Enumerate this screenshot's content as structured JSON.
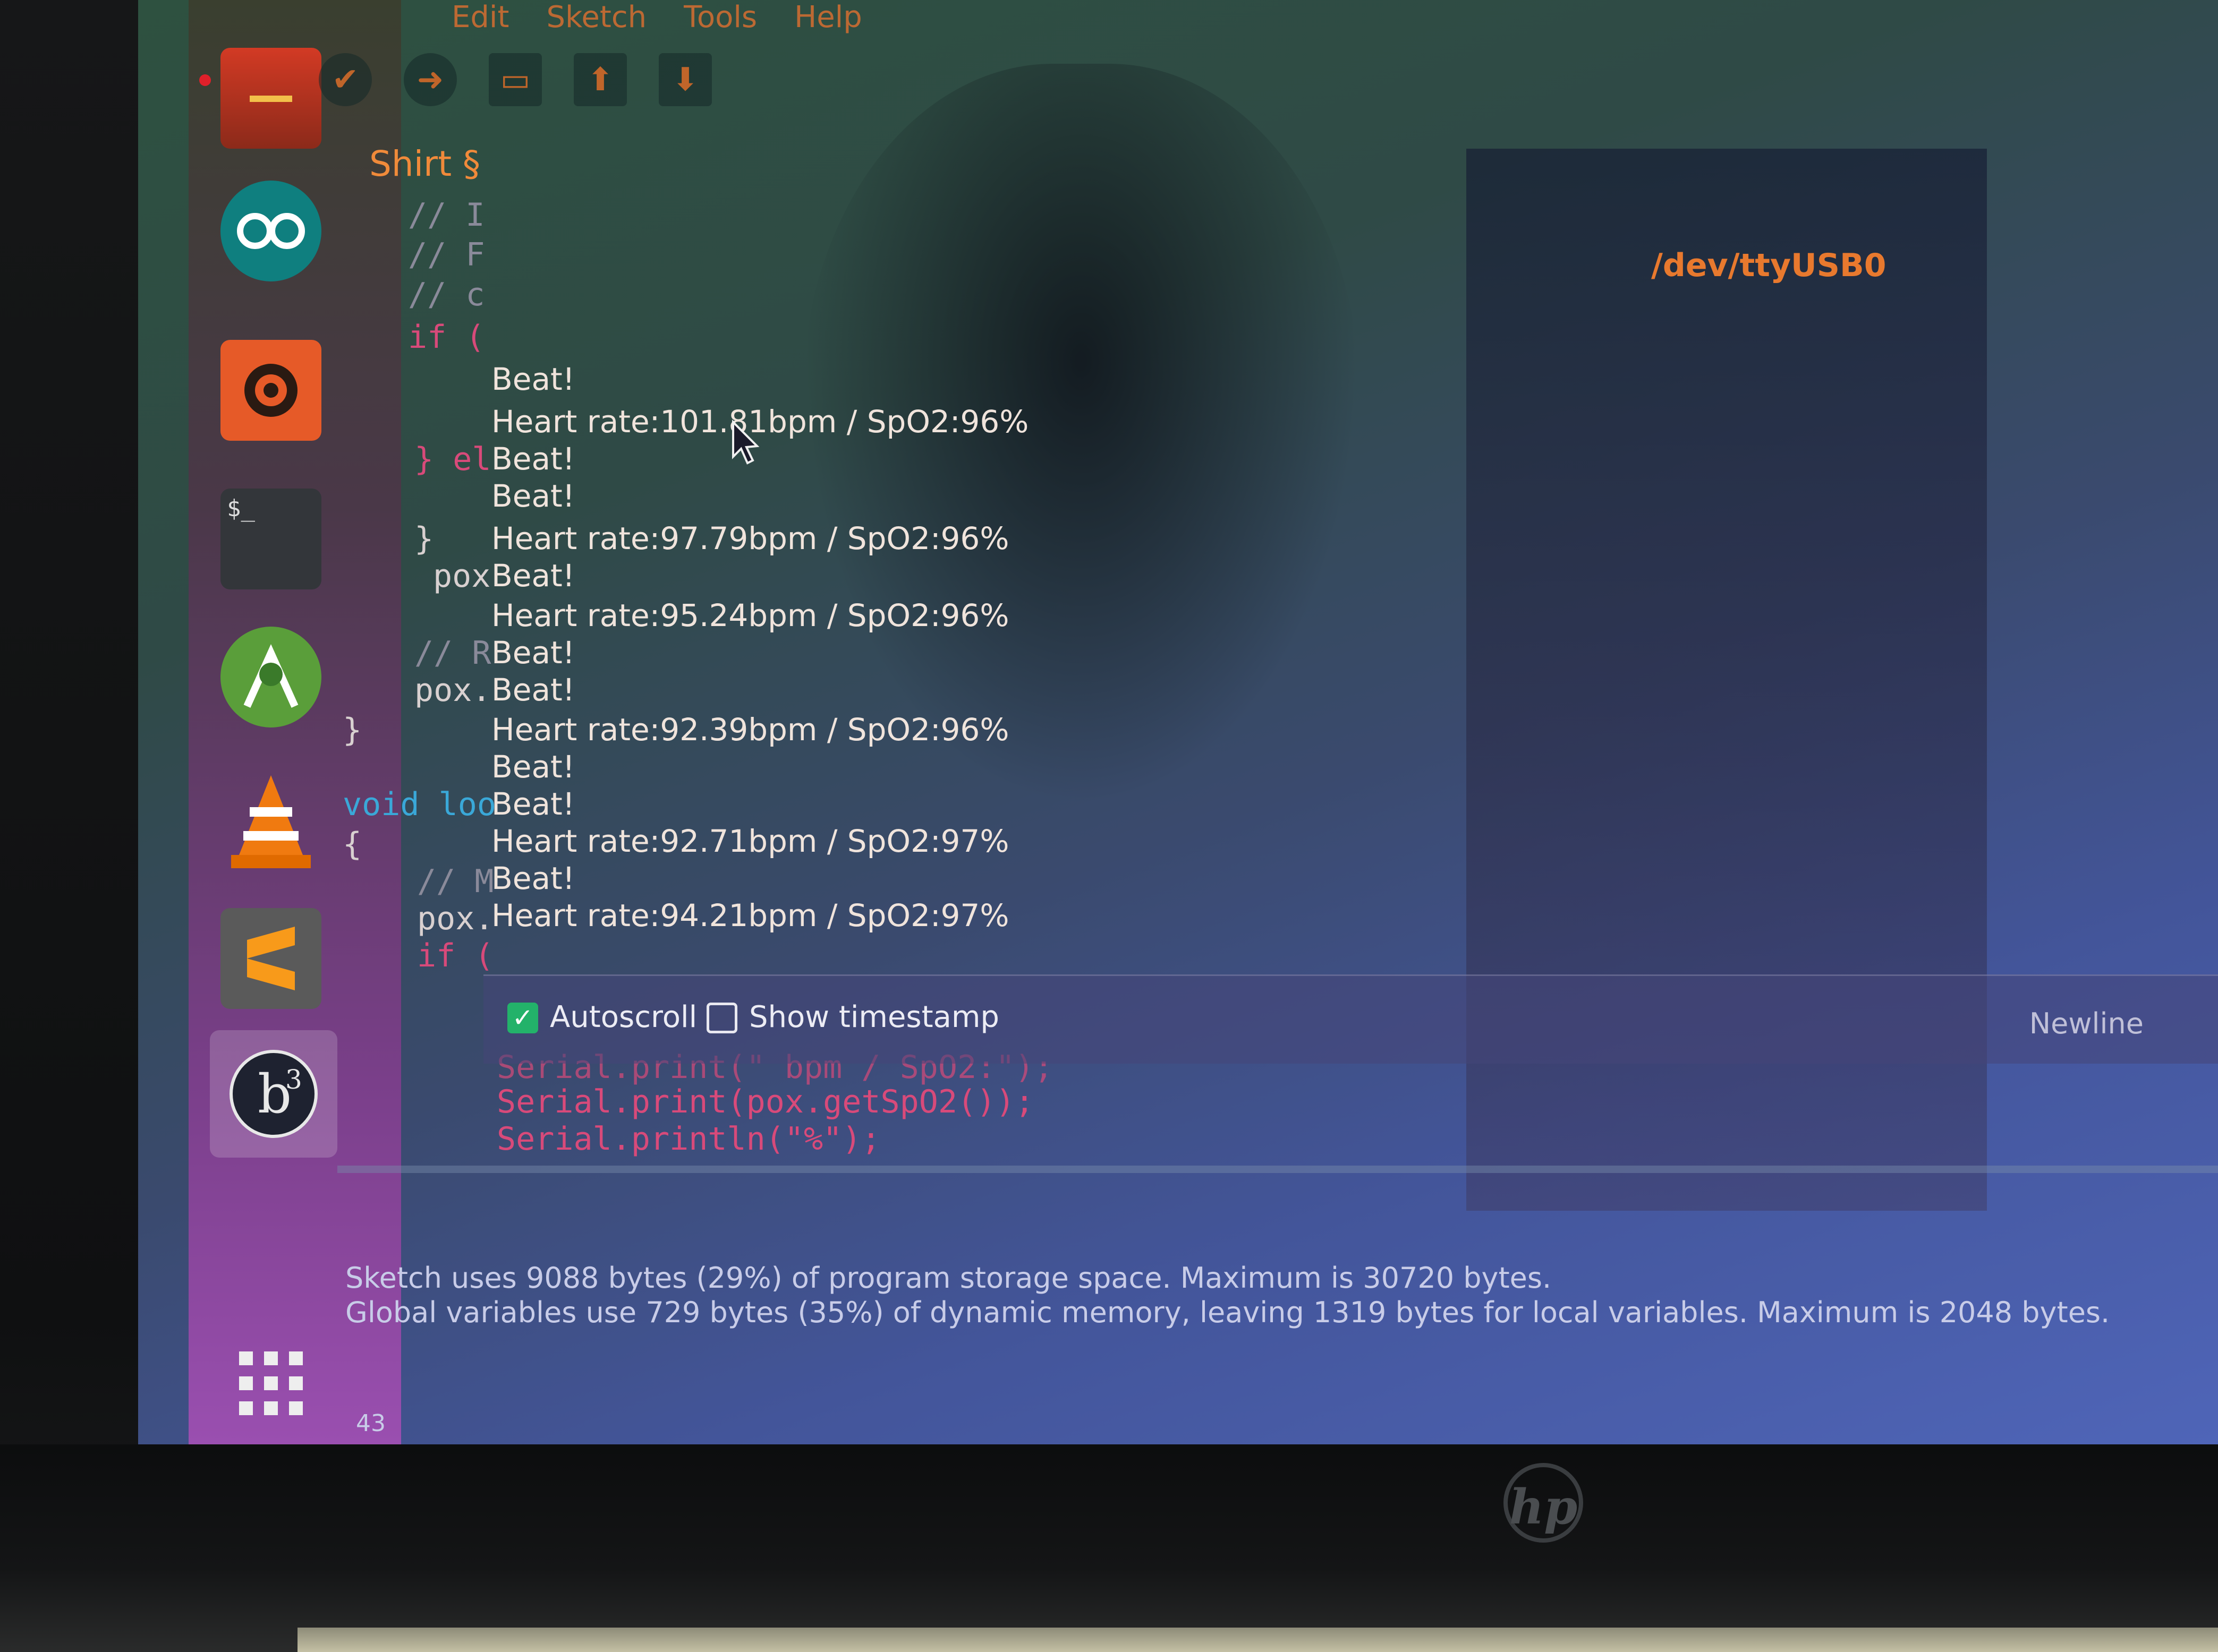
{
  "menu": [
    "Edit",
    "Sketch",
    "Tools",
    "Help"
  ],
  "editor": {
    "tab_title": "Shirt §",
    "code_lines": [
      "// I",
      "// F",
      "// c",
      "if (",
      "} el",
      "}",
      "pox",
      "// R",
      "pox.",
      "}",
      "void loo",
      "{",
      "// M",
      "pox.",
      "if (",
      "Serial.print(\" bpm / SpO2:\");",
      "Serial.print(pox.getSpO2());",
      "Serial.println(\"%\");"
    ]
  },
  "serial_monitor": {
    "port": "/dev/ttyUSB0",
    "lines": [
      "Beat!",
      "Heart rate:101.81bpm / SpO2:96%",
      "Beat!",
      "Beat!",
      "Heart rate:97.79bpm / SpO2:96%",
      "Beat!",
      "Heart rate:95.24bpm / SpO2:96%",
      "Beat!",
      "Beat!",
      "Heart rate:92.39bpm / SpO2:96%",
      "Beat!",
      "Beat!",
      "Heart rate:92.71bpm / SpO2:97%",
      "Beat!",
      "Heart rate:94.21bpm / SpO2:97%"
    ],
    "autoscroll_label": "Autoscroll",
    "autoscroll_checked": true,
    "timestamp_label": "Show timestamp",
    "timestamp_checked": false,
    "line_ending": "Newline"
  },
  "console": {
    "line1": "Sketch uses 9088 bytes (29%) of program storage space. Maximum is 30720 bytes.",
    "line2": "Global variables use 729 bytes (35%) of dynamic memory, leaving 1319 bytes for local variables. Maximum is 2048 bytes.",
    "line_number": "43"
  },
  "launcher": {
    "icons": [
      "files-icon",
      "arduino-icon",
      "speaker-icon",
      "terminal-icon",
      "android-studio-icon",
      "vlc-icon",
      "sublime-text-icon",
      "b3-app-icon",
      "app-grid-icon"
    ],
    "terminal_glyph": "$_"
  },
  "device": {
    "brand": "hp"
  },
  "colors": {
    "accent": "#e8792e",
    "checkbox_on": "#23b26a",
    "keyword": "#d84a7a",
    "type_keyword": "#3aa8d8"
  }
}
